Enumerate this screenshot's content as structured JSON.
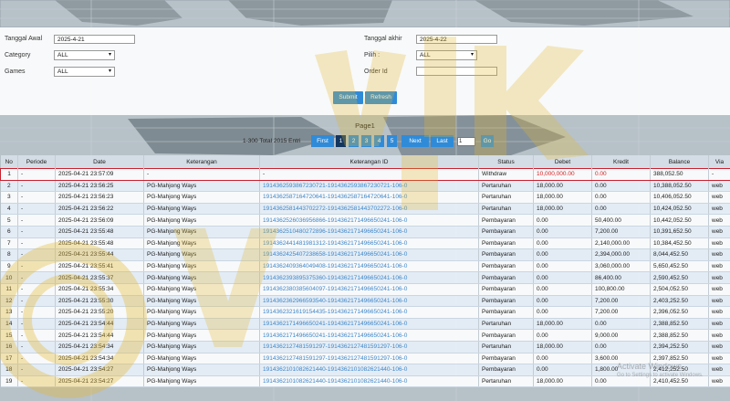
{
  "filters": {
    "tanggal_awal_label": "Tanggal Awal",
    "tanggal_awal_value": "2025-4-21",
    "tanggal_akhir_label": "Tanggal akhir",
    "tanggal_akhir_value": "2025-4-22",
    "category_label": "Category",
    "category_value": "ALL",
    "pilih_label": "Pilih :",
    "pilih_value": "ALL",
    "games_label": "Games",
    "games_value": "ALL",
    "order_id_label": "Order Id",
    "order_id_value": "",
    "submit_label": "Submit",
    "refresh_label": "Refresh"
  },
  "pager": {
    "title": "Page1",
    "total": "1-300 Total 2015 Entri",
    "first": "First",
    "pages": [
      "1",
      "2",
      "3",
      "4",
      "5"
    ],
    "next": "Next",
    "last": "Last",
    "page_input": "1",
    "go": "Go"
  },
  "table": {
    "headers": [
      "No",
      "Periode",
      "Date",
      "Keterangan",
      "Keterangan ID",
      "Status",
      "Debet",
      "Kredit",
      "Balance",
      "Via"
    ],
    "rows": [
      [
        "1",
        "-",
        "2025-04-21 23:57:09",
        "-",
        "-",
        "Withdraw",
        "10,000,000.00",
        "0.00",
        "388,052.50",
        "-"
      ],
      [
        "2",
        "-",
        "2025-04-21 23:56:25",
        "PG-Mahjong Ways",
        "1914362593867230721-1914362593867230721-106-0",
        "Pertaruhan",
        "18,000.00",
        "0.00",
        "10,388,052.50",
        "web"
      ],
      [
        "3",
        "-",
        "2025-04-21 23:56:23",
        "PG-Mahjong Ways",
        "1914362587164720641-1914362587164720641-106-0",
        "Pertaruhan",
        "18,000.00",
        "0.00",
        "10,406,052.50",
        "web"
      ],
      [
        "4",
        "-",
        "2025-04-21 23:56:22",
        "PG-Mahjong Ways",
        "1914362581443702272-1914362581443702272-106-0",
        "Pertaruhan",
        "18,000.00",
        "0.00",
        "10,424,052.50",
        "web"
      ],
      [
        "5",
        "-",
        "2025-04-21 23:56:09",
        "PG-Mahjong Ways",
        "1914362526036956866-1914362171496650241-106-0",
        "Pembayaran",
        "0.00",
        "50,400.00",
        "10,442,052.50",
        "web"
      ],
      [
        "6",
        "-",
        "2025-04-21 23:55:48",
        "PG-Mahjong Ways",
        "1914362510480272896-1914362171496650241-106-0",
        "Pembayaran",
        "0.00",
        "7,200.00",
        "10,391,652.50",
        "web"
      ],
      [
        "7",
        "-",
        "2025-04-21 23:55:48",
        "PG-Mahjong Ways",
        "1914362441481981312-1914362171496650241-106-0",
        "Pembayaran",
        "0.00",
        "2,140,000.00",
        "10,384,452.50",
        "web"
      ],
      [
        "8",
        "-",
        "2025-04-21 23:55:44",
        "PG-Mahjong Ways",
        "1914362425407238658-1914362171496650241-106-0",
        "Pembayaran",
        "0.00",
        "2,394,000.00",
        "8,044,452.50",
        "web"
      ],
      [
        "9",
        "-",
        "2025-04-21 23:55:41",
        "PG-Mahjong Ways",
        "1914362409364049408-1914362171496650241-106-0",
        "Pembayaran",
        "0.00",
        "3,060,000.00",
        "5,650,452.50",
        "web"
      ],
      [
        "10",
        "-",
        "2025-04-21 23:55:37",
        "PG-Mahjong Ways",
        "1914362393895375360-1914362171496650241-106-0",
        "Pembayaran",
        "0.00",
        "86,400.00",
        "2,590,452.50",
        "web"
      ],
      [
        "11",
        "-",
        "2025-04-21 23:55:34",
        "PG-Mahjong Ways",
        "1914362380385604097-1914362171496650241-106-0",
        "Pembayaran",
        "0.00",
        "100,800.00",
        "2,504,052.50",
        "web"
      ],
      [
        "12",
        "-",
        "2025-04-21 23:55:30",
        "PG-Mahjong Ways",
        "1914362362966593540-1914362171496650241-106-0",
        "Pembayaran",
        "0.00",
        "7,200.00",
        "2,403,252.50",
        "web"
      ],
      [
        "13",
        "-",
        "2025-04-21 23:55:20",
        "PG-Mahjong Ways",
        "1914362321619154435-1914362171496650241-106-0",
        "Pembayaran",
        "0.00",
        "7,200.00",
        "2,396,052.50",
        "web"
      ],
      [
        "14",
        "-",
        "2025-04-21 23:54:44",
        "PG-Mahjong Ways",
        "1914362171496650241-1914362171496650241-106-0",
        "Pertaruhan",
        "18,000.00",
        "0.00",
        "2,388,852.50",
        "web"
      ],
      [
        "15",
        "-",
        "2025-04-21 23:54:44",
        "PG-Mahjong Ways",
        "1914362171496650241-1914362171496650241-106-0",
        "Pembayaran",
        "0.00",
        "9,000.00",
        "2,388,852.50",
        "web"
      ],
      [
        "16",
        "-",
        "2025-04-21 23:54:34",
        "PG-Mahjong Ways",
        "1914362127481591297-1914362127481591297-106-0",
        "Pertaruhan",
        "18,000.00",
        "0.00",
        "2,394,252.50",
        "web"
      ],
      [
        "17",
        "-",
        "2025-04-21 23:54:34",
        "PG-Mahjong Ways",
        "1914362127481591297-1914362127481591297-106-0",
        "Pembayaran",
        "0.00",
        "3,600.00",
        "2,397,852.50",
        "web"
      ],
      [
        "18",
        "-",
        "2025-04-21 23:54:27",
        "PG-Mahjong Ways",
        "1914362101082621440-1914362101082621440-106-0",
        "Pembayaran",
        "0.00",
        "1,800.00",
        "2,412,252.50",
        "web"
      ],
      [
        "19",
        "-",
        "2025-04-21 23:54:27",
        "PG-Mahjong Ways",
        "1914362101082621440-1914362101082621440-106-0",
        "Pertaruhan",
        "18,000.00",
        "0.00",
        "2,410,452.50",
        "web"
      ]
    ]
  },
  "overlay": {
    "activate_title": "Activate Windows",
    "activate_sub": "Go to Settings to activate Windows."
  },
  "colors": {
    "accent": "#2f8bd8",
    "active_page": "#13365e",
    "highlight": "#c8202f",
    "watermark_gold": "#e4b62a"
  }
}
